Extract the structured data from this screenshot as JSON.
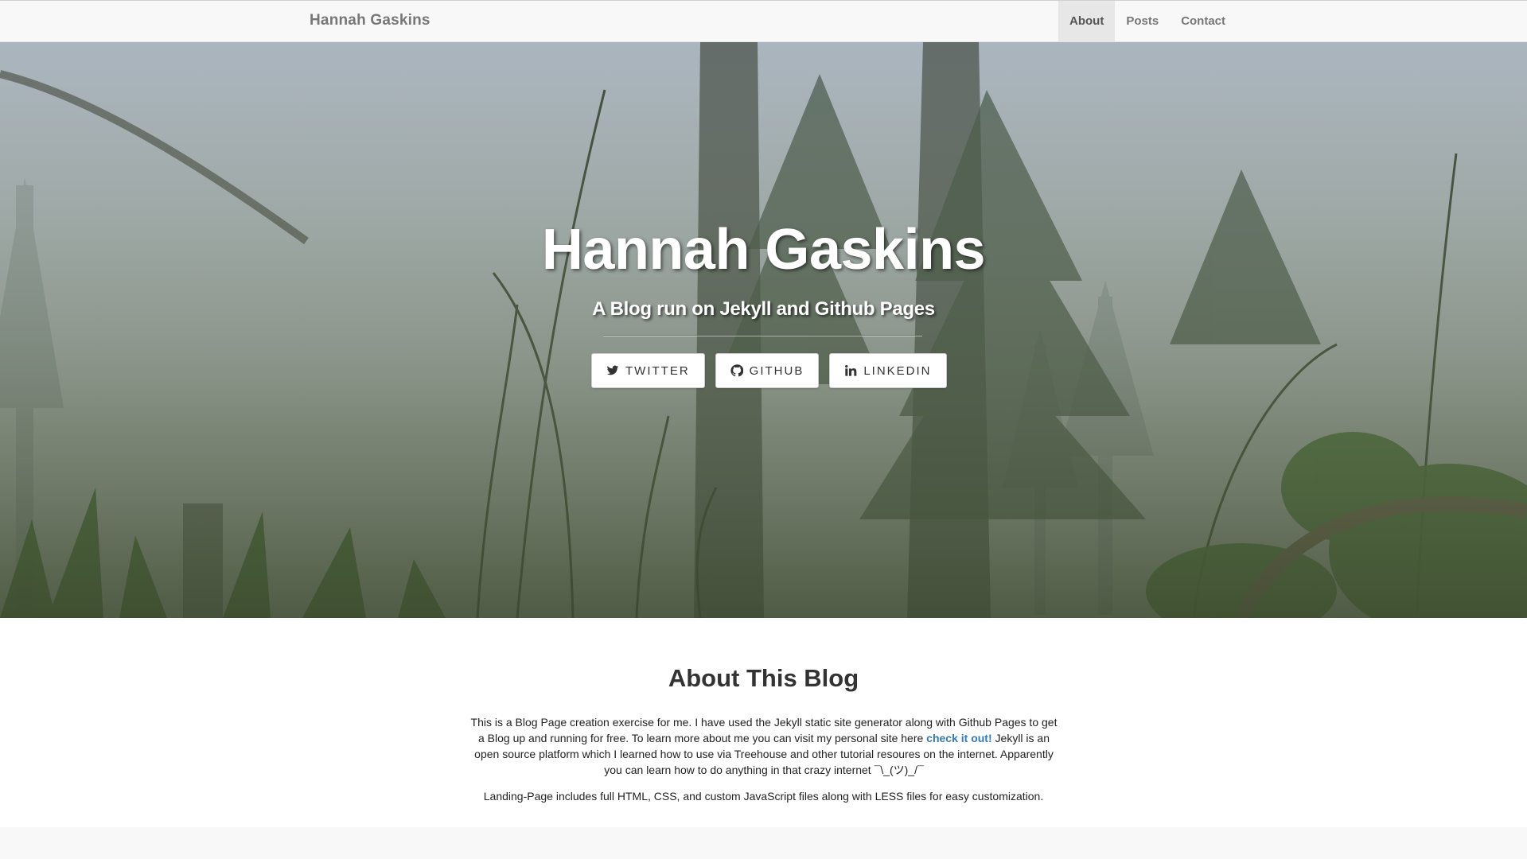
{
  "navbar": {
    "brand": "Hannah Gaskins",
    "items": [
      {
        "label": "About",
        "active": true
      },
      {
        "label": "Posts",
        "active": false
      },
      {
        "label": "Contact",
        "active": false
      }
    ]
  },
  "hero": {
    "title": "Hannah Gaskins",
    "subtitle": "A Blog run on Jekyll and Github Pages",
    "social": [
      {
        "label": "TWITTER",
        "icon": "twitter-icon"
      },
      {
        "label": "GITHUB",
        "icon": "github-icon"
      },
      {
        "label": "LINKEDIN",
        "icon": "linkedin-icon"
      }
    ]
  },
  "about": {
    "heading": "About This Blog",
    "paragraph_before_link": "This is a Blog Page creation exercise for me. I have used the Jekyll static site generator along with Github Pages to get a Blog up and running for free. To learn more about me you can visit my personal site here ",
    "link_text": "check it out!",
    "paragraph_after_link": " Jekyll is an open source platform which I learned how to use via Treehouse and other tutorial resoures on the internet. Apparently you can learn how to do anything in that crazy internet ¯\\_(ツ)_/¯",
    "paragraph2": "Landing-Page includes full HTML, CSS, and custom JavaScript files along with LESS files for easy customization."
  },
  "colors": {
    "link": "#337ab7",
    "nav_text": "#777777",
    "nav_active_bg": "#e7e7e7",
    "navbar_bg": "#f8f8f8"
  }
}
